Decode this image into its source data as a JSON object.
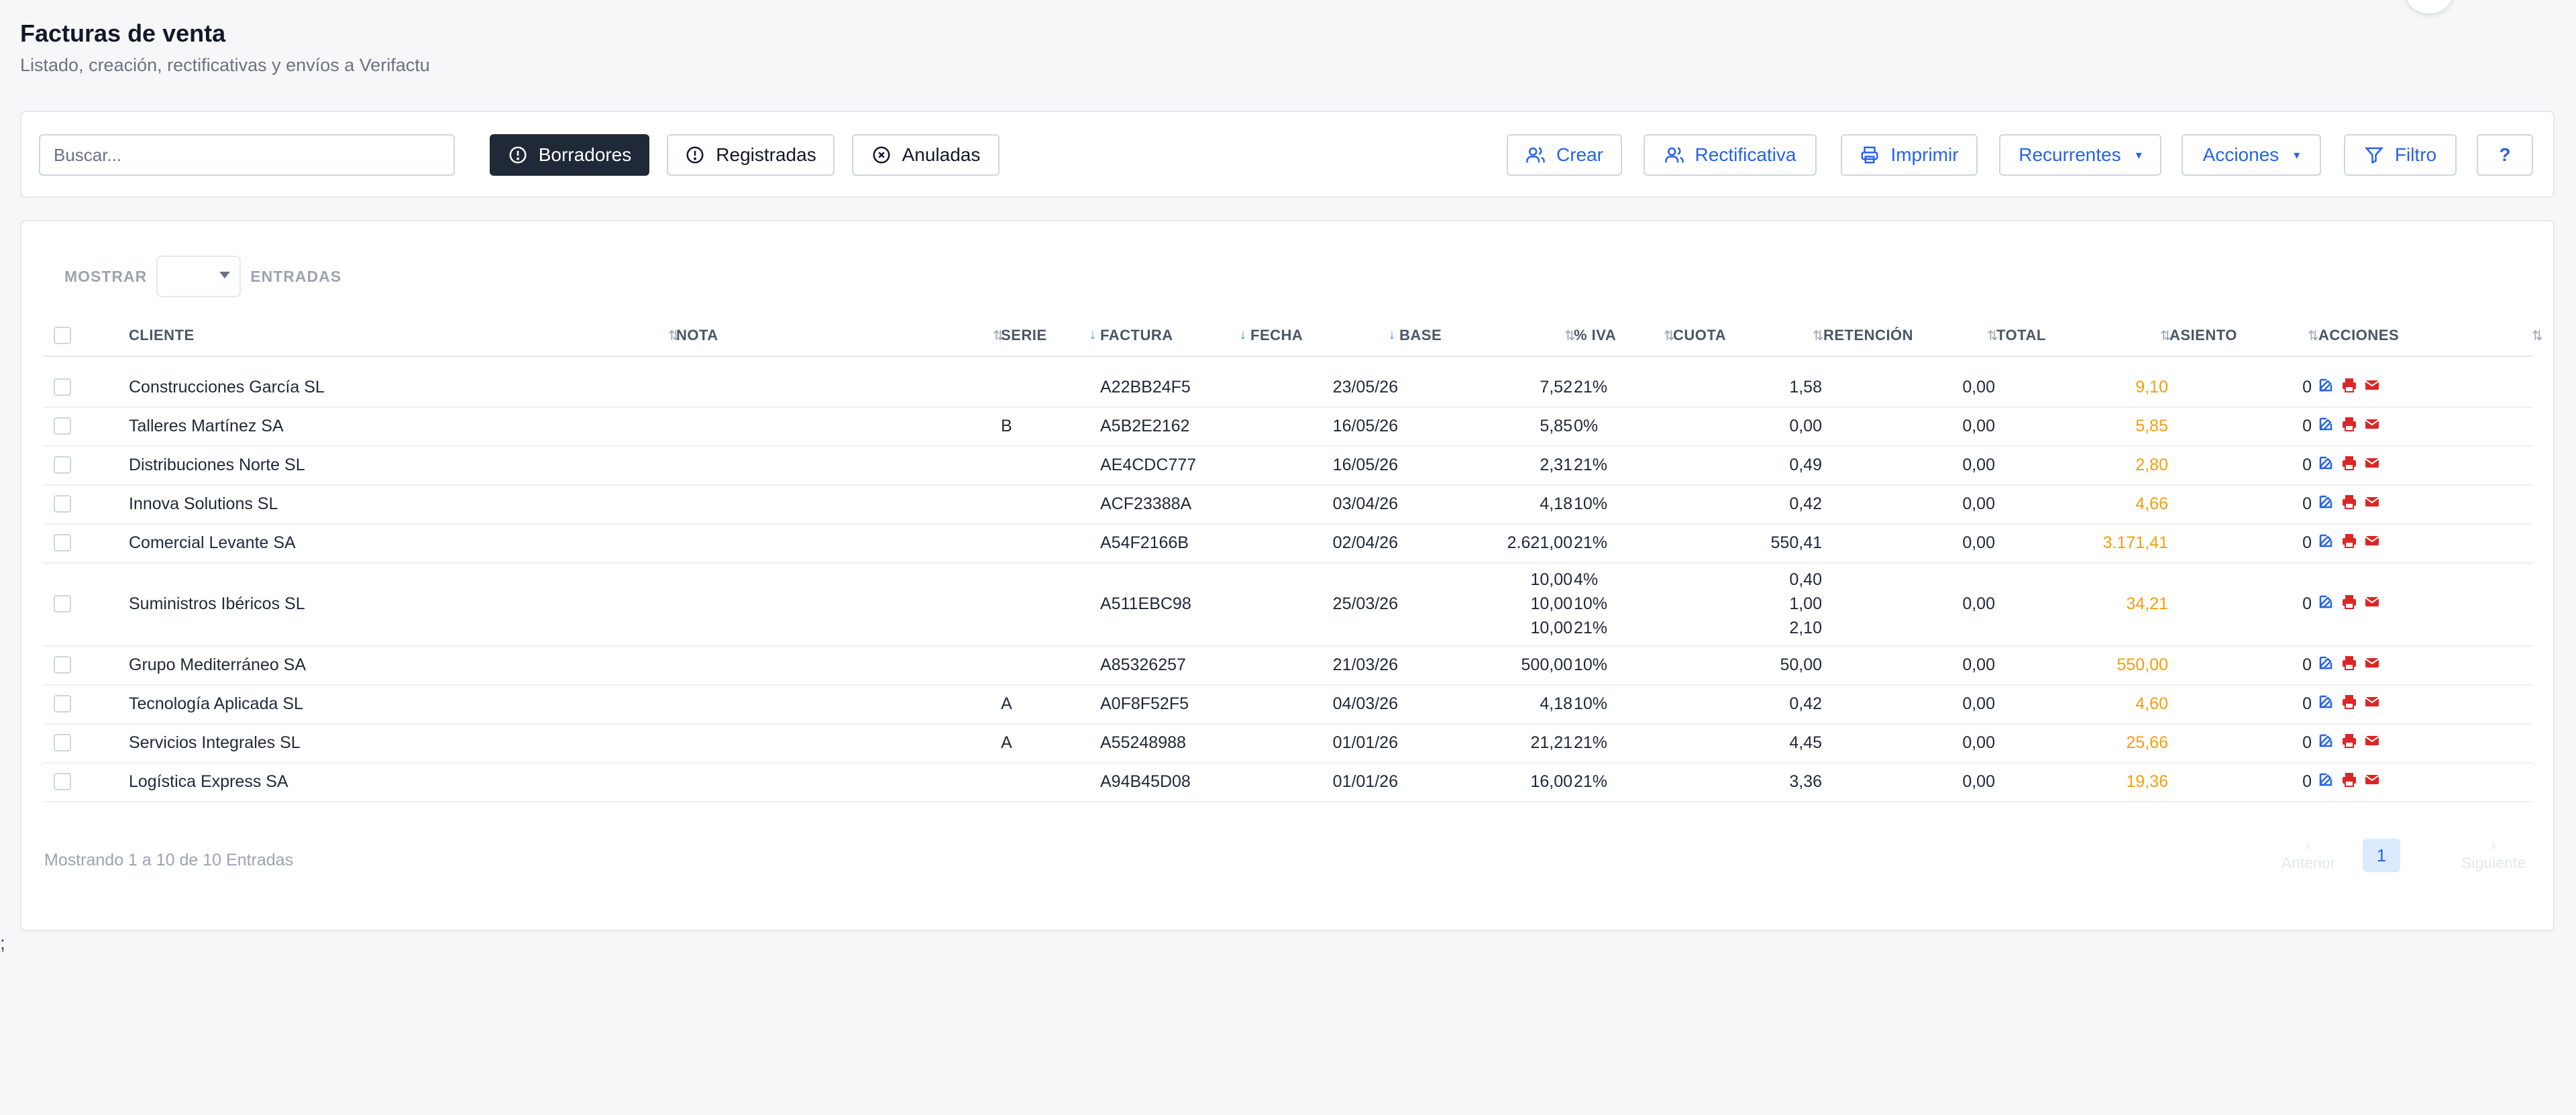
{
  "header": {
    "title": "Facturas de venta",
    "subtitle": "Listado, creación, rectificativas y envíos a Verifactu"
  },
  "toolbar": {
    "search_placeholder": "Buscar...",
    "filters": [
      {
        "label": "Borradores",
        "icon": "alert-circle-icon",
        "active": true
      },
      {
        "label": "Registradas",
        "icon": "alert-circle-icon",
        "active": false
      },
      {
        "label": "Anuladas",
        "icon": "x-circle-icon",
        "active": false
      }
    ],
    "actions": [
      {
        "label": "Crear",
        "icon": "users-icon"
      },
      {
        "label": "Rectificativa",
        "icon": "users-icon"
      },
      {
        "label": "Imprimir",
        "icon": "printer-icon"
      },
      {
        "label": "Recurrentes",
        "icon": "caret-down-icon"
      },
      {
        "label": "Acciones",
        "icon": "caret-down-icon"
      },
      {
        "label": "Filtro",
        "icon": "filter-icon"
      },
      {
        "label": "?",
        "icon": "help-icon"
      }
    ]
  },
  "table": {
    "show_label": "MOSTRAR",
    "entries_label": "ENTRADAS",
    "columns": [
      "CLIENTE",
      "NOTA",
      "SERIE",
      "FACTURA",
      "FECHA",
      "BASE",
      "% IVA",
      "CUOTA",
      "RETENCIÓN",
      "TOTAL",
      "ASIENTO",
      "ACCIONES"
    ],
    "rows": [
      {
        "cliente": "Construcciones García SL",
        "nota": "",
        "serie": "",
        "factura": "A22BB24F5",
        "fecha": "23/05/26",
        "base": [
          "7,52"
        ],
        "iva": [
          "21%"
        ],
        "cuota": [
          "1,58"
        ],
        "retencion": "0,00",
        "total": "9,10",
        "asiento": "0"
      },
      {
        "cliente": "Talleres Martínez SA",
        "nota": "",
        "serie": "B",
        "factura": "A5B2E2162",
        "fecha": "16/05/26",
        "base": [
          "5,85"
        ],
        "iva": [
          "0%"
        ],
        "cuota": [
          "0,00"
        ],
        "retencion": "0,00",
        "total": "5,85",
        "asiento": "0"
      },
      {
        "cliente": "Distribuciones Norte SL",
        "nota": "",
        "serie": "",
        "factura": "AE4CDC777",
        "fecha": "16/05/26",
        "base": [
          "2,31"
        ],
        "iva": [
          "21%"
        ],
        "cuota": [
          "0,49"
        ],
        "retencion": "0,00",
        "total": "2,80",
        "asiento": "0"
      },
      {
        "cliente": "Innova Solutions SL",
        "nota": "",
        "serie": "",
        "factura": "ACF23388A",
        "fecha": "03/04/26",
        "base": [
          "4,18"
        ],
        "iva": [
          "10%"
        ],
        "cuota": [
          "0,42"
        ],
        "retencion": "0,00",
        "total": "4,66",
        "asiento": "0"
      },
      {
        "cliente": "Comercial Levante SA",
        "nota": "",
        "serie": "",
        "factura": "A54F2166B",
        "fecha": "02/04/26",
        "base": [
          "2.621,00"
        ],
        "iva": [
          "21%"
        ],
        "cuota": [
          "550,41"
        ],
        "retencion": "0,00",
        "total": "3.171,41",
        "asiento": "0"
      },
      {
        "cliente": "Suministros Ibéricos SL",
        "nota": "",
        "serie": "",
        "factura": "A511EBC98",
        "fecha": "25/03/26",
        "base": [
          "10,00",
          "10,00",
          "10,00"
        ],
        "iva": [
          "4%",
          "10%",
          "21%"
        ],
        "cuota": [
          "0,40",
          "1,00",
          "2,10"
        ],
        "retencion": "0,00",
        "total": "34,21",
        "asiento": "0"
      },
      {
        "cliente": "Grupo Mediterráneo SA",
        "nota": "",
        "serie": "",
        "factura": "A85326257",
        "fecha": "21/03/26",
        "base": [
          "500,00"
        ],
        "iva": [
          "10%"
        ],
        "cuota": [
          "50,00"
        ],
        "retencion": "0,00",
        "total": "550,00",
        "asiento": "0"
      },
      {
        "cliente": "Tecnología Aplicada SL",
        "nota": "",
        "serie": "A",
        "factura": "A0F8F52F5",
        "fecha": "04/03/26",
        "base": [
          "4,18"
        ],
        "iva": [
          "10%"
        ],
        "cuota": [
          "0,42"
        ],
        "retencion": "0,00",
        "total": "4,60",
        "asiento": "0"
      },
      {
        "cliente": "Servicios Integrales SL",
        "nota": "",
        "serie": "A",
        "factura": "A55248988",
        "fecha": "01/01/26",
        "base": [
          "21,21"
        ],
        "iva": [
          "21%"
        ],
        "cuota": [
          "4,45"
        ],
        "retencion": "0,00",
        "total": "25,66",
        "asiento": "0"
      },
      {
        "cliente": "Logística Express SA",
        "nota": "",
        "serie": "",
        "factura": "A94B45D08",
        "fecha": "01/01/26",
        "base": [
          "16,00"
        ],
        "iva": [
          "21%"
        ],
        "cuota": [
          "3,36"
        ],
        "retencion": "0,00",
        "total": "19,36",
        "asiento": "0"
      }
    ],
    "footer": "Mostrando 1 a 10 de 10 Entradas",
    "pagination": {
      "prev": "Anterior",
      "next": "Siguiente",
      "current": "1"
    }
  },
  "stray_text": ";",
  "colors": {
    "accent": "#2563eb",
    "total": "#f59e0b",
    "dark_button": "#1f2937",
    "action_red": "#dc2626"
  }
}
